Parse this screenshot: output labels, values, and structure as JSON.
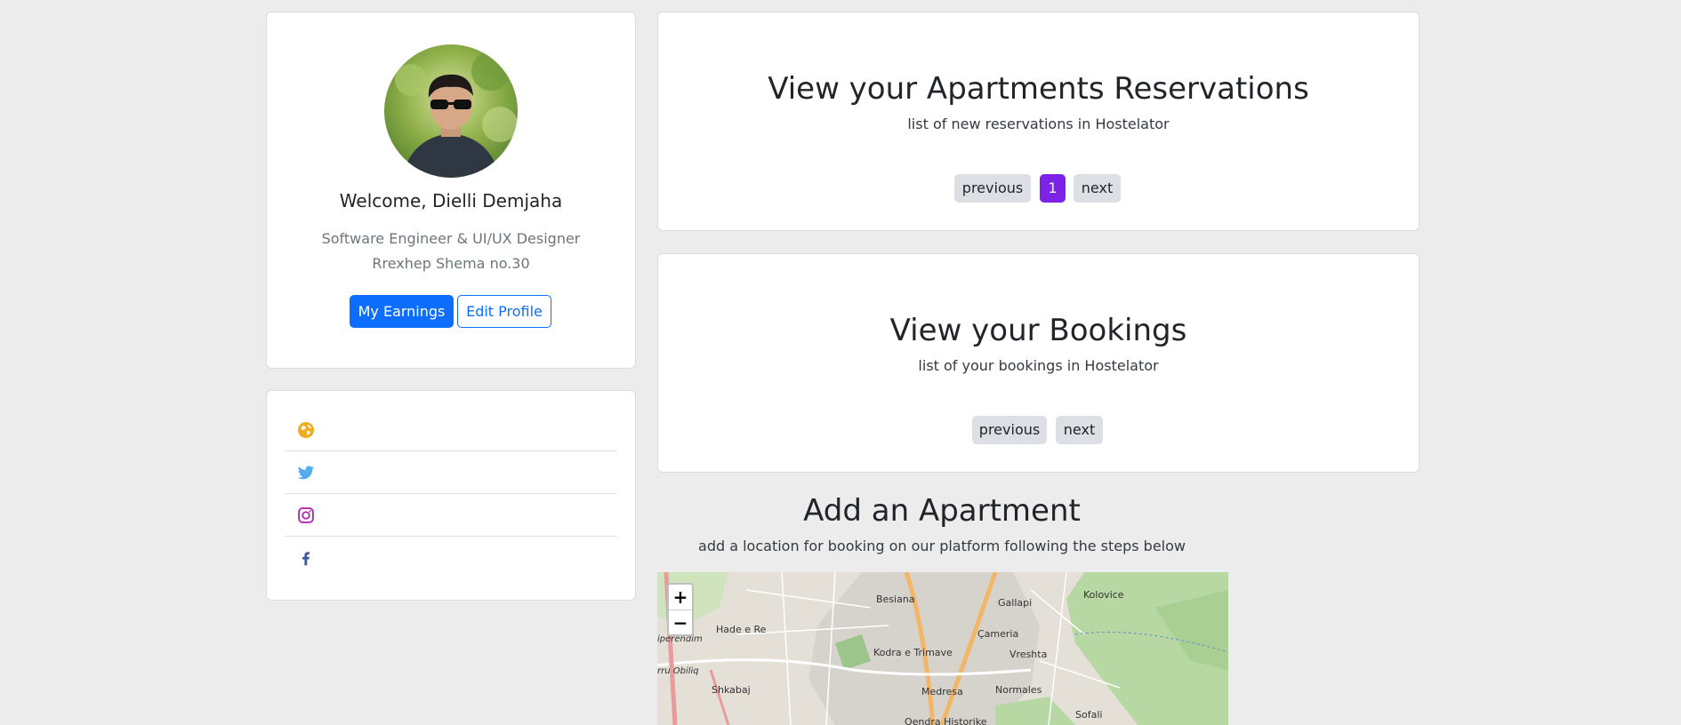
{
  "profile": {
    "welcome": "Welcome, Dielli Demjaha",
    "job_title": "Software Engineer & UI/UX Designer",
    "address": "Rrexhep Shema no.30",
    "earnings_label": "My Earnings",
    "edit_label": "Edit Profile"
  },
  "social": {
    "items": [
      {
        "icon": "globe-icon",
        "color": "#f0ad1f"
      },
      {
        "icon": "twitter-icon",
        "color": "#55acee"
      },
      {
        "icon": "instagram-icon",
        "color": "#ac2bac"
      },
      {
        "icon": "facebook-icon",
        "color": "#3b5998"
      }
    ]
  },
  "reservations": {
    "title": "View your Apartments Reservations",
    "subtitle": "list of new reservations in Hostelator",
    "previous": "previous",
    "page": "1",
    "next": "next"
  },
  "bookings": {
    "title": "View your Bookings",
    "subtitle": "list of your bookings in Hostelator",
    "previous": "previous",
    "next": "next"
  },
  "add_apartment": {
    "title": "Add an Apartment",
    "subtitle": "add a location for booking on our platform following the steps below"
  },
  "map": {
    "zoom_in": "+",
    "zoom_out": "−",
    "labels": {
      "besiana": "Besiana",
      "gallapi": "Gallapi",
      "kolovice": "Kolovice",
      "hade": "Hade e Re",
      "perendim": "iperendim",
      "cameria": "Çameria",
      "kodra": "Kodra e Trimave",
      "vreshta": "Vreshta",
      "obiliq": "rru Obiliq",
      "shkabaj": "Shkabaj",
      "medresa": "Medresa",
      "normales": "Normales",
      "sofali": "Sofali",
      "qendra": "Qendra Historike"
    }
  },
  "colors": {
    "primary": "#0d6efd",
    "pager_active": "#7d22e6",
    "background": "#ececec"
  }
}
